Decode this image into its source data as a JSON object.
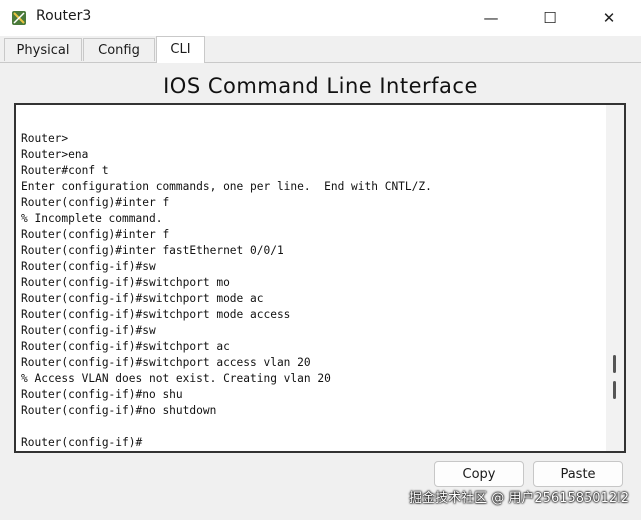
{
  "window": {
    "title": "Router3",
    "controls": {
      "minimize": "—",
      "maximize": "☐",
      "close": "✕"
    }
  },
  "tabs": [
    {
      "label": "Physical",
      "active": false
    },
    {
      "label": "Config",
      "active": false
    },
    {
      "label": "CLI",
      "active": true
    }
  ],
  "cli": {
    "heading": "IOS Command Line Interface",
    "lines": [
      "Router>",
      "Router>ena",
      "Router#conf t",
      "Enter configuration commands, one per line.  End with CNTL/Z.",
      "Router(config)#inter f",
      "% Incomplete command.",
      "Router(config)#inter f",
      "Router(config)#inter fastEthernet 0/0/1",
      "Router(config-if)#sw",
      "Router(config-if)#switchport mo",
      "Router(config-if)#switchport mode ac",
      "Router(config-if)#switchport mode access",
      "Router(config-if)#sw",
      "Router(config-if)#switchport ac",
      "Router(config-if)#switchport access vlan 20",
      "% Access VLAN does not exist. Creating vlan 20",
      "Router(config-if)#no shu",
      "Router(config-if)#no shutdown",
      "",
      "Router(config-if)#"
    ]
  },
  "actions": {
    "copy_label": "Copy",
    "paste_label": "Paste"
  },
  "watermark": "掘金技术社区 @ 用户2561585012l2",
  "colors": {
    "terminal_border": "#333333",
    "terminal_bg": "#ffffff",
    "window_bg": "#f0f0f0"
  }
}
